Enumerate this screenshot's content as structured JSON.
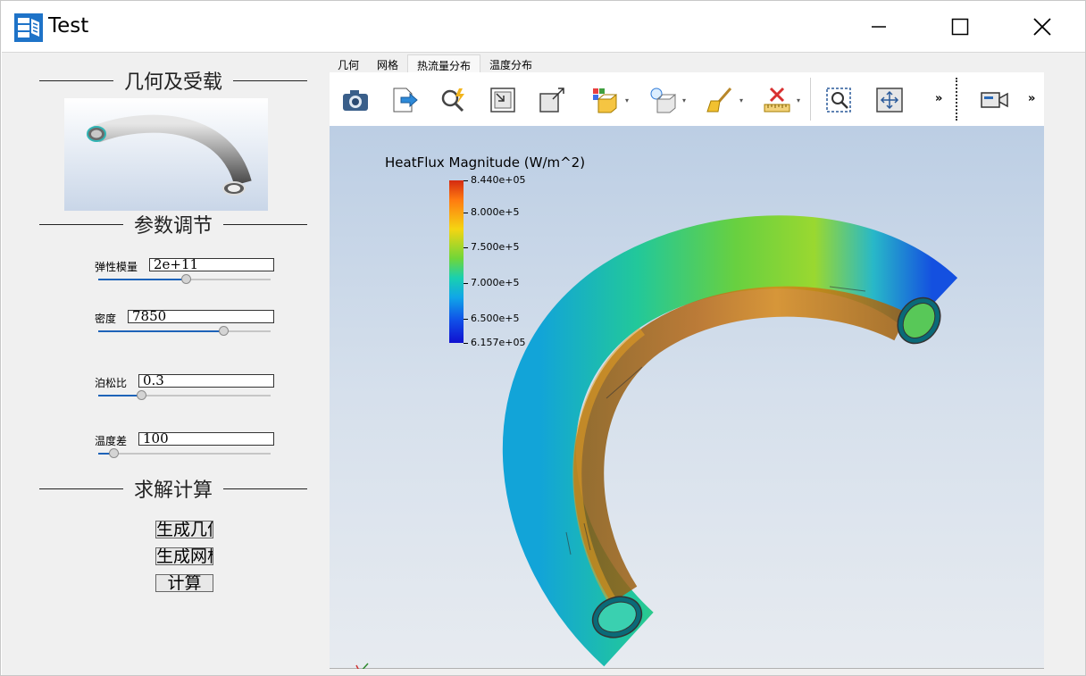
{
  "window": {
    "title": "Test",
    "minimize_icon": "minimize-icon",
    "maximize_icon": "maximize-icon",
    "close_icon": "close-icon"
  },
  "left": {
    "geometry_title": "几何及受载",
    "params_title": "参数调节",
    "solve_title": "求解计算",
    "params": [
      {
        "label": "弹性模量",
        "value": "2e+11",
        "slider_fraction": 0.5
      },
      {
        "label": "密度",
        "value": "7850",
        "slider_fraction": 0.72
      },
      {
        "label": "泊松比",
        "value": "0.3",
        "slider_fraction": 0.25
      },
      {
        "label": "温度差",
        "value": "100",
        "slider_fraction": 0.09
      }
    ],
    "buttons": {
      "gen_geometry": "生成几何",
      "gen_mesh": "生成网格",
      "compute": "计算"
    }
  },
  "tabs": [
    "几何",
    "网格",
    "热流量分布",
    "温度分布"
  ],
  "active_tab": "热流量分布",
  "toolbar": {
    "icons": [
      "camera-icon",
      "export-icon",
      "probe-icon",
      "reset-camera-icon",
      "zoom-box-icon",
      "color-by-icon",
      "lighting-icon",
      "clear-icon",
      "ruler-icon",
      "zoom-selection-icon",
      "pan-icon",
      "overflow-icon",
      "video-camera-icon",
      "overflow-icon"
    ]
  },
  "legend": {
    "title": "HeatFlux Magnitude (W/m^2)",
    "labels": [
      "8.440e+05",
      "8.000e+5",
      "7.500e+5",
      "7.000e+5",
      "6.500e+5",
      "6.157e+05"
    ],
    "max": 844000,
    "min": 615700,
    "colors": [
      "#d42a10",
      "#f5d512",
      "#70d638",
      "#19d0b0",
      "#1050e8",
      "#1010d0"
    ]
  }
}
